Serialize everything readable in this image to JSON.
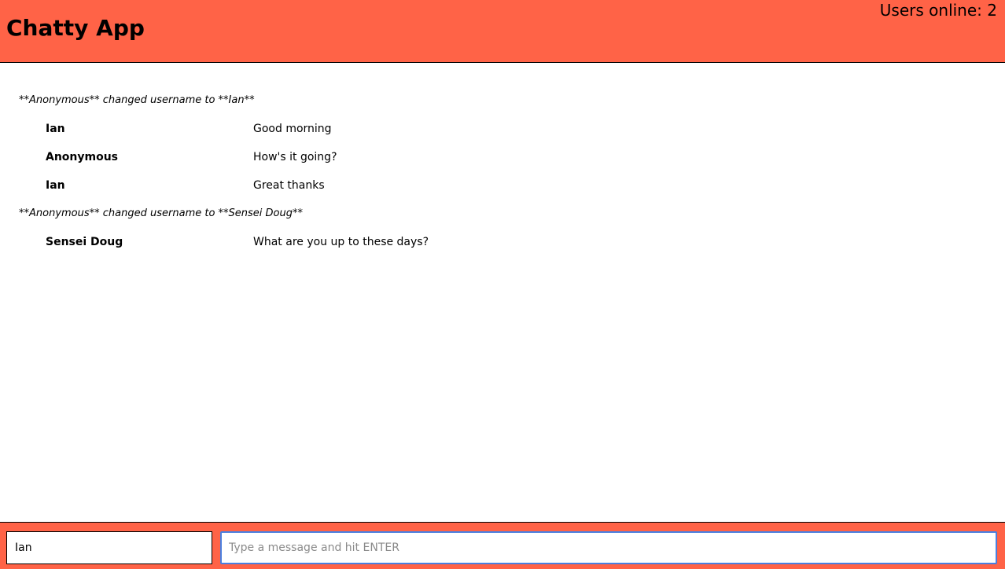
{
  "header": {
    "title": "Chatty App",
    "users_online": "Users online: 2"
  },
  "messages": [
    {
      "type": "system",
      "text": "**Anonymous** changed username to **Ian**"
    },
    {
      "type": "chat",
      "username": "Ian",
      "content": "Good morning"
    },
    {
      "type": "chat",
      "username": "Anonymous",
      "content": "How's it going?"
    },
    {
      "type": "chat",
      "username": "Ian",
      "content": "Great thanks"
    },
    {
      "type": "system",
      "text": "**Anonymous** changed username to **Sensei Doug**"
    },
    {
      "type": "chat",
      "username": "Sensei Doug",
      "content": "What are you up to these days?"
    }
  ],
  "chatbar": {
    "username_value": "Ian",
    "message_placeholder": "Type a message and hit ENTER",
    "message_value": ""
  },
  "colors": {
    "accent": "#ff6347",
    "focus": "#4a7fe0"
  }
}
